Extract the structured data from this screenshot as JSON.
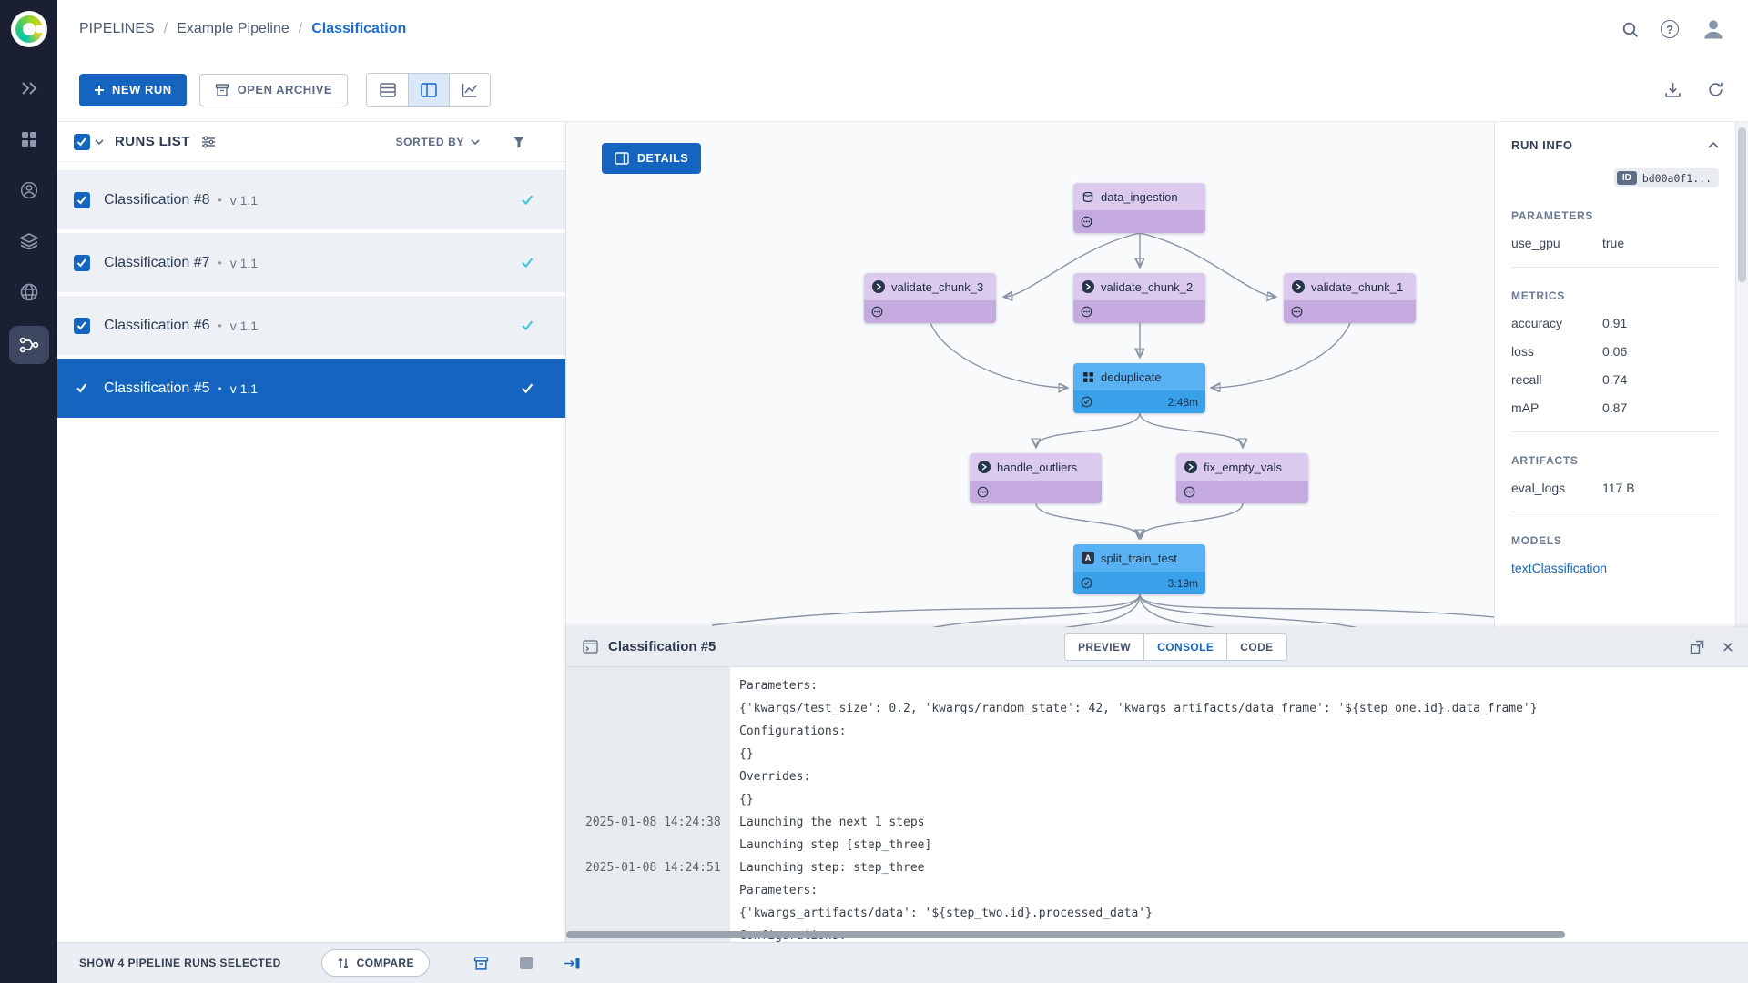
{
  "breadcrumb": {
    "section": "PIPELINES",
    "project": "Example Pipeline",
    "page": "Classification"
  },
  "toolbar": {
    "new_run_label": "NEW RUN",
    "open_archive_label": "OPEN ARCHIVE"
  },
  "runs_panel": {
    "title": "RUNS LIST",
    "sorted_by_label": "SORTED BY",
    "runs": [
      {
        "name": "Classification #8",
        "version": "v 1.1"
      },
      {
        "name": "Classification #7",
        "version": "v 1.1"
      },
      {
        "name": "Classification #6",
        "version": "v 1.1"
      },
      {
        "name": "Classification #5",
        "version": "v 1.1"
      }
    ]
  },
  "dag": {
    "details_label": "DETAILS",
    "nodes": [
      {
        "label": "data_ingestion"
      },
      {
        "label": "validate_chunk_3"
      },
      {
        "label": "validate_chunk_2"
      },
      {
        "label": "validate_chunk_1"
      },
      {
        "label": "deduplicate",
        "time": "2:48m"
      },
      {
        "label": "handle_outliers"
      },
      {
        "label": "fix_empty_vals"
      },
      {
        "label": "split_train_test",
        "time": "3:19m"
      }
    ]
  },
  "run_info": {
    "title": "RUN INFO",
    "id_label": "ID",
    "id_value": "bd00a0f1...",
    "sections": {
      "parameters": {
        "title": "PARAMETERS",
        "rows": [
          {
            "label": "use_gpu",
            "value": "true"
          }
        ]
      },
      "metrics": {
        "title": "METRICS",
        "rows": [
          {
            "label": "accuracy",
            "value": "0.91"
          },
          {
            "label": "loss",
            "value": "0.06"
          },
          {
            "label": "recall",
            "value": "0.74"
          },
          {
            "label": "mAP",
            "value": "0.87"
          }
        ]
      },
      "artifacts": {
        "title": "ARTIFACTS",
        "rows": [
          {
            "label": "eval_logs",
            "value": "117 B"
          }
        ]
      },
      "models": {
        "title": "MODELS",
        "link": "textClassification"
      }
    }
  },
  "console": {
    "title": "Classification #5",
    "tabs": [
      "PREVIEW",
      "CONSOLE",
      "CODE"
    ],
    "lines": [
      {
        "ts": "",
        "text": "Parameters:"
      },
      {
        "ts": "",
        "text": "{'kwargs/test_size': 0.2, 'kwargs/random_state': 42, 'kwargs_artifacts/data_frame': '${step_one.id}.data_frame'}"
      },
      {
        "ts": "",
        "text": "Configurations:"
      },
      {
        "ts": "",
        "text": "{}"
      },
      {
        "ts": "",
        "text": "Overrides:"
      },
      {
        "ts": "",
        "text": "{}"
      },
      {
        "ts": "2025-01-08 14:24:38",
        "text": "Launching the next 1 steps"
      },
      {
        "ts": "",
        "text": "Launching step [step_three]"
      },
      {
        "ts": "2025-01-08 14:24:51",
        "text": "Launching step: step_three"
      },
      {
        "ts": "",
        "text": "Parameters:"
      },
      {
        "ts": "",
        "text": "{'kwargs_artifacts/data': '${step_two.id}.processed_data'}"
      },
      {
        "ts": "",
        "text": "Configurations:"
      }
    ]
  },
  "footer": {
    "selection_text": "SHOW 4 PIPELINE RUNS SELECTED",
    "compare_label": "COMPARE"
  }
}
